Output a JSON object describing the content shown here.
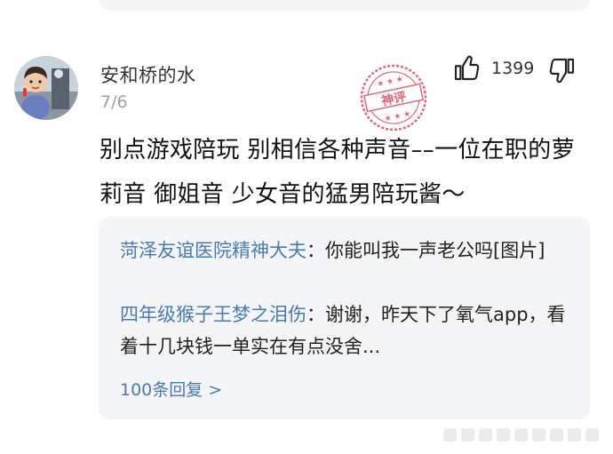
{
  "comment": {
    "username": "安和桥的水",
    "date": "7/6",
    "likes": "1399",
    "text": "别点游戏陪玩 别相信各种声音––一位在职的萝莉音 御姐音 少女音的猛男陪玩酱～",
    "stamp_text": "神评"
  },
  "replies": {
    "items": [
      {
        "author": "菏泽友谊医院精神大夫",
        "separator": "：",
        "content": "你能叫我一声老公吗[图片]"
      },
      {
        "author": "四年级猴子王梦之泪伤",
        "separator": "：",
        "content": "谢谢，昨天下了氧气app，看着十几块钱一单实在有点没舍..."
      }
    ],
    "more_label": "100条回复 >"
  },
  "colors": {
    "link_blue": "#4a7ab5",
    "stamp_red": "#e0556a",
    "reply_bg": "#f4f5f7"
  },
  "icons": {
    "like": "thumbs-up-icon",
    "dislike": "thumbs-down-icon"
  }
}
